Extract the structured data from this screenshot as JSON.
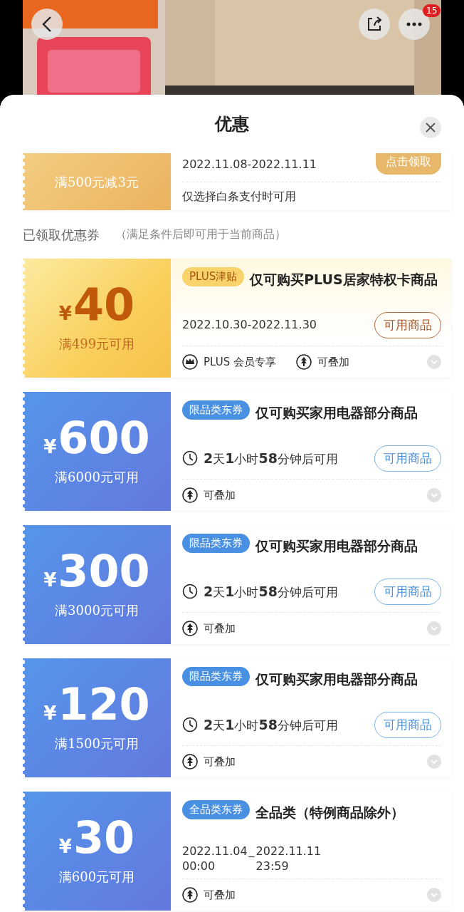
{
  "top_bar": {
    "badge": "15"
  },
  "sheet": {
    "title": "优惠"
  },
  "partial_coupon": {
    "condition": "满500元减3元",
    "validity": "2022.11.08-2022.11.11",
    "button": "点击领取",
    "note": "仅选择白条支付时可用"
  },
  "section": {
    "title": "已领取优惠券",
    "note": "（满足条件后即可用于当前商品）"
  },
  "coupons": [
    {
      "kind": "plus",
      "currency": "¥",
      "amount": "40",
      "condition": "满499元可用",
      "tag": "PLUS津贴",
      "title": "仅可购买PLUS居家特权卡商品",
      "validity": "2022.10.30-2022.11.30",
      "button": "可用商品",
      "features": [
        {
          "kind": "crown",
          "label": "PLUS 会员专享"
        },
        {
          "kind": "stack",
          "label": "可叠加"
        }
      ]
    },
    {
      "kind": "category",
      "currency": "¥",
      "amount": "600",
      "condition": "满6000元可用",
      "tag": "限品类东券",
      "title": "仅可购买家用电器部分商品",
      "countdown": "**2**天**1**小时**58**分钟后可用",
      "button": "可用商品",
      "features": [
        {
          "kind": "stack",
          "label": "可叠加"
        }
      ]
    },
    {
      "kind": "category",
      "currency": "¥",
      "amount": "300",
      "condition": "满3000元可用",
      "tag": "限品类东券",
      "title": "仅可购买家用电器部分商品",
      "countdown": "**2**天**1**小时**58**分钟后可用",
      "button": "可用商品",
      "features": [
        {
          "kind": "stack",
          "label": "可叠加"
        }
      ]
    },
    {
      "kind": "category",
      "currency": "¥",
      "amount": "120",
      "condition": "满1500元可用",
      "tag": "限品类东券",
      "title": "仅可购买家用电器部分商品",
      "countdown": "**2**天**1**小时**58**分钟后可用",
      "button": "可用商品",
      "features": [
        {
          "kind": "stack",
          "label": "可叠加"
        }
      ]
    },
    {
      "kind": "category",
      "currency": "¥",
      "amount": "30",
      "condition": "满600元可用",
      "tag": "全品类东券",
      "title": "全品类（特例商品除外）",
      "validity_start": {
        "date": "2022.11.04",
        "time": "00:00"
      },
      "separator": "_",
      "validity_end": {
        "date": "2022.11.11",
        "time": "23:59"
      },
      "features": [
        {
          "kind": "stack",
          "label": "可叠加"
        }
      ]
    }
  ]
}
